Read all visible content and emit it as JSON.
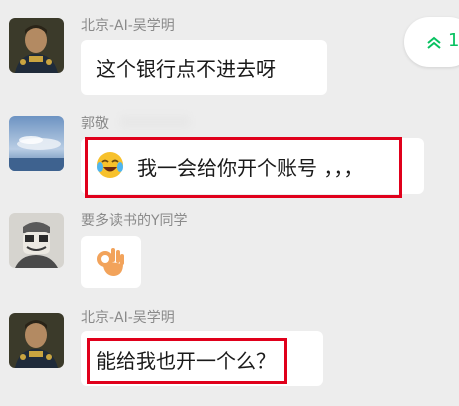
{
  "unread": {
    "count": "1",
    "icon": "double-chevron-up-icon",
    "color": "#07c160"
  },
  "messages": [
    {
      "sender": "北京-AI-吴学明",
      "text": "这个银行点不进去呀",
      "avatar": "portrait-avatar"
    },
    {
      "sender": "郭敬",
      "text": "我一会给你开个账号 ，，，",
      "emoji": "crying-laughing-emoji",
      "avatar": "sky-landscape-avatar",
      "highlighted": true
    },
    {
      "sender": "要多读书的Y同学",
      "emoji": "ok-hand-emoji",
      "avatar": "masked-figure-avatar"
    },
    {
      "sender": "北京-AI-吴学明",
      "text": "能给我也开一个么？",
      "avatar": "portrait-avatar",
      "highlighted_part": "能给我也开一个么"
    }
  ],
  "colors": {
    "background": "#ededed",
    "bubble": "#ffffff",
    "highlight": "#e0001b",
    "sender_text": "#8a8a8a"
  }
}
